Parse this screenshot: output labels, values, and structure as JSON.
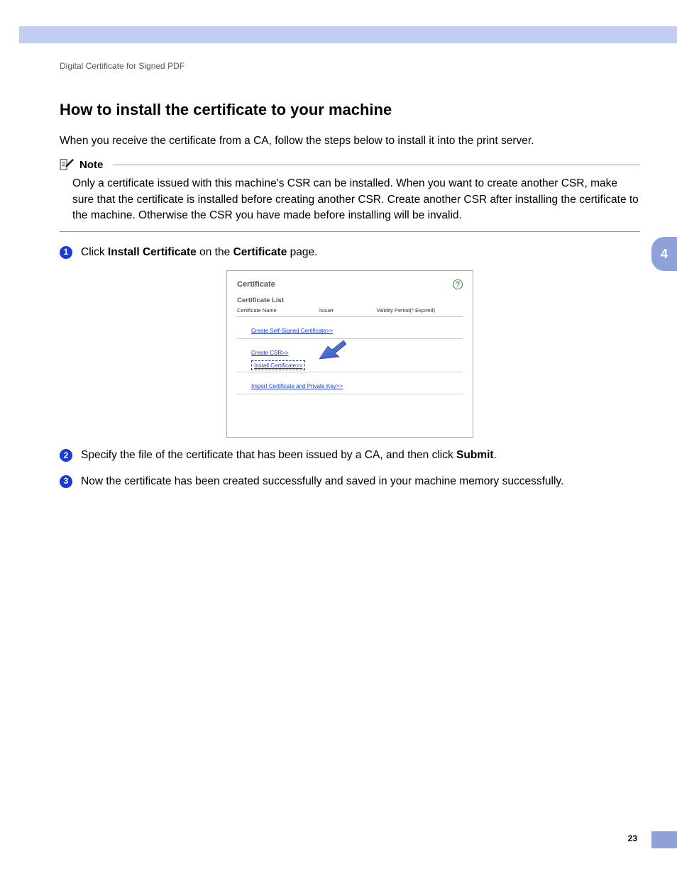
{
  "breadcrumb": "Digital Certificate for Signed PDF",
  "heading": "How to install the certificate to your machine",
  "intro": "When you receive the certificate from a CA, follow the steps below to install it into the print server.",
  "note": {
    "label": "Note",
    "body": "Only a certificate issued with this machine's CSR can be installed. When you want to create another CSR, make sure that the certificate is installed before creating another CSR. Create another CSR after installing the certificate to the machine. Otherwise the CSR you have made before installing will be invalid."
  },
  "steps": {
    "s1_pre": "Click ",
    "s1_b1": "Install Certificate",
    "s1_mid": " on the ",
    "s1_b2": "Certificate",
    "s1_post": " page.",
    "s2_pre": "Specify the file of the certificate that has been issued by a CA, and then click ",
    "s2_b": "Submit",
    "s2_post": ".",
    "s3": "Now the certificate has been created successfully and saved in your machine memory successfully."
  },
  "screenshot": {
    "title": "Certificate",
    "help": "?",
    "subtitle": "Certificate List",
    "col1": "Certificate Name",
    "col2": "Issuer",
    "col3": "Validity Period(*:Expired)",
    "link1": "Create Self-Signed Certificate>>",
    "link2": "Create CSR>>",
    "link3": "Install Certificate>>",
    "link4": "Import Certificate and Private Key>>"
  },
  "chapter": "4",
  "page": "23"
}
